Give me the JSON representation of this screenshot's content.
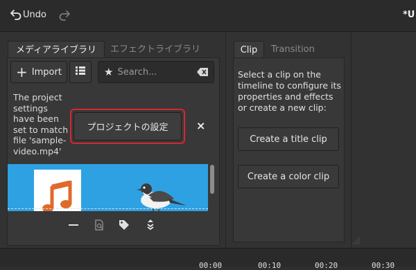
{
  "header": {
    "undo_label": "Undo",
    "title": "*U"
  },
  "media_tabs": [
    {
      "label": "メディアライブラリ",
      "active": true
    },
    {
      "label": "エフェクトライブラリ",
      "active": false
    }
  ],
  "toolbar": {
    "import_label": "Import",
    "search_placeholder": "Search..."
  },
  "info": {
    "lines": [
      "The project",
      "settings",
      "have been",
      "set to match",
      "file 'sample-",
      "video.mp4'"
    ],
    "project_settings_label": "プロジェクトの設定",
    "close_glyph": "×"
  },
  "props_tabs": [
    {
      "label": "Clip",
      "active": true
    },
    {
      "label": "Transition",
      "active": false
    }
  ],
  "props": {
    "lines": [
      "Select a clip on the",
      "timeline to configure its",
      "properties and effects",
      "or create a new clip:"
    ],
    "title_clip_label": "Create a title clip",
    "color_clip_label": "Create a color clip"
  },
  "timeline": {
    "ticks": [
      "00:00",
      "00:10",
      "00:20",
      "00:30"
    ]
  },
  "colors": {
    "thumb_blue": "#2ea1e2",
    "highlight_red": "#d8262d",
    "music_orange": "#e06a2c"
  }
}
